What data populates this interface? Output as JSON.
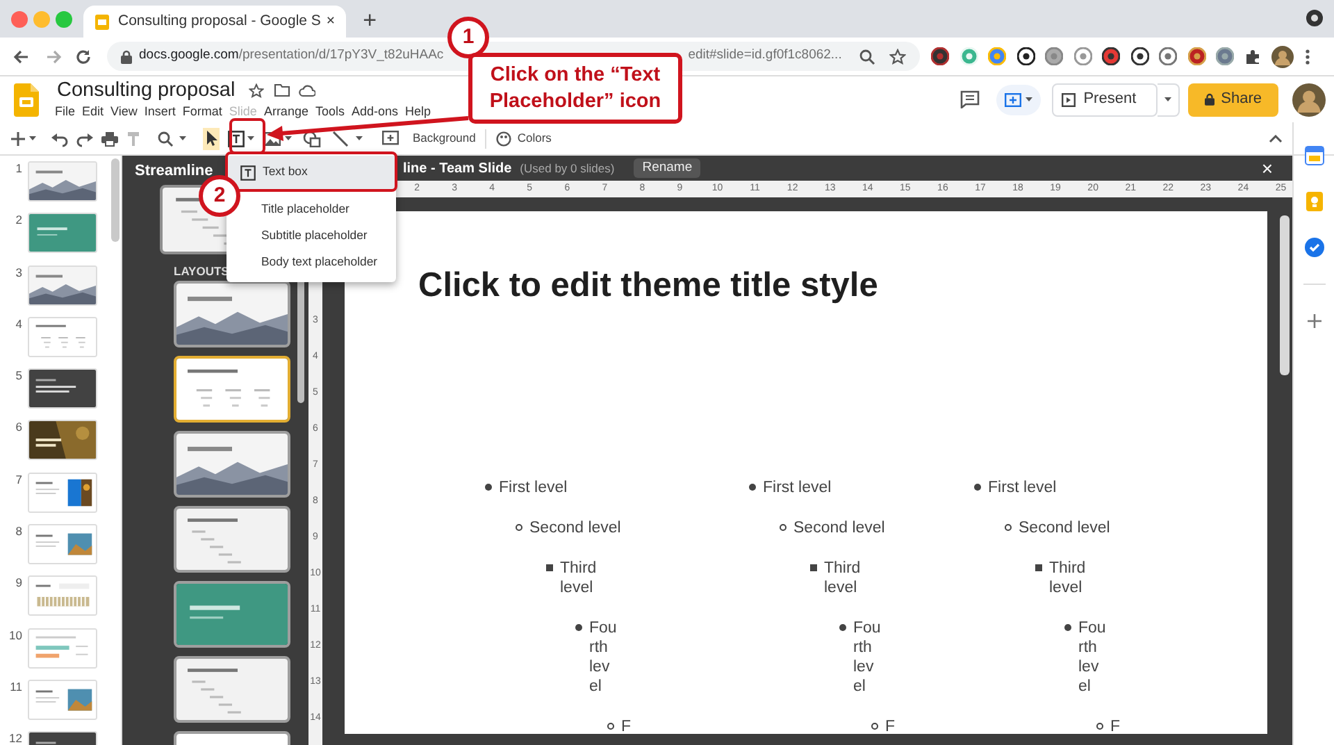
{
  "browser": {
    "tab_title": "Consulting proposal - Google S",
    "tab_close": "×",
    "new_tab": "+",
    "url_host": "docs.google.com",
    "url_path": "/presentation/d/17pY3V_t82uHAAc",
    "url_tail": "edit#slide=id.gf0f1c8062..."
  },
  "app": {
    "title": "Consulting proposal",
    "menu": [
      {
        "label": "File",
        "disabled": false
      },
      {
        "label": "Edit",
        "disabled": false
      },
      {
        "label": "View",
        "disabled": false
      },
      {
        "label": "Insert",
        "disabled": false
      },
      {
        "label": "Format",
        "disabled": false
      },
      {
        "label": "Slide",
        "disabled": true
      },
      {
        "label": "Arrange",
        "disabled": false
      },
      {
        "label": "Tools",
        "disabled": false
      },
      {
        "label": "Add-ons",
        "disabled": false
      },
      {
        "label": "Help",
        "disabled": false
      }
    ],
    "present": "Present",
    "share": "Share"
  },
  "toolbar": {
    "background": "Background",
    "colors": "Colors"
  },
  "text_menu": [
    {
      "label": "Text box",
      "selected": true
    },
    {
      "label": "Title placeholder",
      "selected": false
    },
    {
      "label": "Subtitle placeholder",
      "selected": false
    },
    {
      "label": "Body text placeholder",
      "selected": false
    }
  ],
  "slides": [
    {
      "number": "1",
      "kind": "mountain"
    },
    {
      "number": "2",
      "kind": "teal"
    },
    {
      "number": "3",
      "kind": "mountain"
    },
    {
      "number": "4",
      "kind": "columns"
    },
    {
      "number": "5",
      "kind": "dark"
    },
    {
      "number": "6",
      "kind": "photo"
    },
    {
      "number": "7",
      "kind": "bluephoto"
    },
    {
      "number": "8",
      "kind": "photoright"
    },
    {
      "number": "9",
      "kind": "bars"
    },
    {
      "number": "10",
      "kind": "hbars"
    },
    {
      "number": "11",
      "kind": "photoright"
    },
    {
      "number": "12",
      "kind": "dark"
    }
  ],
  "theme_panel": {
    "theme_name": "Streamline",
    "section": "LAYOUTS",
    "layouts": [
      {
        "kind": "mountain",
        "selected": false
      },
      {
        "kind": "columns",
        "selected": true
      },
      {
        "kind": "mountain",
        "selected": false
      },
      {
        "kind": "list",
        "selected": false
      },
      {
        "kind": "teal",
        "selected": false
      },
      {
        "kind": "list",
        "selected": false
      },
      {
        "kind": "plain",
        "selected": false
      }
    ],
    "editor_title": "line - Team Slide",
    "usage": "(Used by 0 slides)",
    "rename": "Rename",
    "close": "×"
  },
  "ruler": {
    "horizontal": [
      "2",
      "3",
      "4",
      "5",
      "6",
      "7",
      "8",
      "9",
      "10",
      "11",
      "12",
      "13",
      "14",
      "15",
      "16",
      "17",
      "18",
      "19",
      "20",
      "21",
      "22",
      "23",
      "24",
      "25"
    ],
    "vertical": [
      "3",
      "4",
      "5",
      "6",
      "7",
      "8",
      "9",
      "10",
      "11",
      "12",
      "13",
      "14"
    ]
  },
  "slide": {
    "title": "Click to edit theme title style",
    "columns": [
      {
        "levels": [
          "First level",
          "Second level",
          "Third level",
          "Fourth level",
          "F"
        ]
      },
      {
        "levels": [
          "First level",
          "Second level",
          "Third level",
          "Fourth level",
          "F"
        ]
      },
      {
        "levels": [
          "First level",
          "Second level",
          "Third level",
          "Fourth level",
          "F"
        ]
      }
    ]
  },
  "annotations": [
    {
      "number": "1",
      "text": "Click on the “Text Placeholder” icon"
    },
    {
      "number": "2"
    }
  ]
}
